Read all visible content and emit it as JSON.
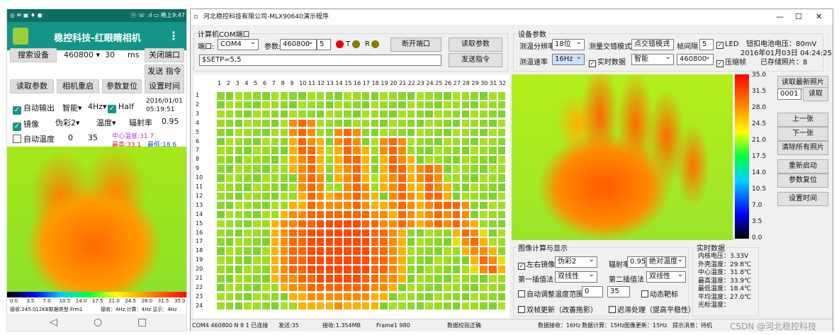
{
  "phone": {
    "status_left": "◎ ✉ ▣ ♦ ●",
    "status_right": "ⓝ ☏ .ıl ▭ 晚上9:47",
    "app_title": "稳控科技-红眼睛相机",
    "menu_icon": "⋮",
    "search_button": "搜索设备",
    "baud": "460800",
    "ms_value": "30",
    "ms_label": "ms",
    "close_port": "关闭端口",
    "send_cmd": "发送 指令",
    "read_params": "读取参数",
    "restart": "相机重启",
    "reset_params": "参数复位",
    "set_time": "设置时间",
    "auto_output": "自动输出",
    "mode": "智能",
    "freq": "4Hz",
    "half": "Half",
    "date": "2016/01/01",
    "time": "05:19:51",
    "mirror": "镜像",
    "palette": "伪彩2",
    "temp_label": "温度",
    "emis_label": "辐射率",
    "emis_value": "0.95",
    "auto_temp": "自动温度",
    "tmin": "0",
    "tmax": "35",
    "center_temp": "中心温度:31.7",
    "max_temp": "最高:33.1",
    "min_temp": "最低:18.6",
    "scale": [
      "0.0",
      "3.5",
      "7.0",
      "10.5",
      "14.0",
      "17.5",
      "21.0",
      "24.5",
      "28.0",
      "31.5",
      "35.0"
    ],
    "footer_left": "接收:245.012KB数据类型:Frm1",
    "footer_right": "接收：4Hz 计算：4Hz 显示：4Hz",
    "nav_back": "◁",
    "nav_home": "○",
    "nav_recent": "□"
  },
  "win": {
    "title": "河北稳控科技有限公司-MLX90640演示程序",
    "min": "—",
    "max": "☐",
    "close": "✕",
    "com_group": "计算机COM端口",
    "port_label": "端口:",
    "port_value": "COM4",
    "param_label": "参数:",
    "param_value": "460800",
    "param_num": "5",
    "t_label": "T",
    "r_label": "R",
    "disconnect": "断开端口",
    "read_params": "读取参数",
    "cmd_value": "$SETP=5,5",
    "send_cmd": "发送指令",
    "dev_group": "设备参数",
    "res_label": "测温分辨率",
    "res_value": "18位",
    "interleave_label": "测量交错模式",
    "interleave_value": "点交错模式",
    "interval_label": "帧间隔",
    "interval_value": "5",
    "led_label": "LED",
    "rate_label": "测温速率",
    "rate_value": "16Hz",
    "realtime_label": "实时数据",
    "mode_value": "智能",
    "baud_value": "460800",
    "compress_label": "压缩帧",
    "battery": "钮扣电池电压：80mV",
    "datetime": "2016年01月03日 04:24:25",
    "photos": "已存储照片：8",
    "cols": [
      "1",
      "2",
      "3",
      "4",
      "5",
      "6",
      "7",
      "8",
      "9",
      "10",
      "11",
      "12",
      "13",
      "14",
      "15",
      "16",
      "17",
      "18",
      "19",
      "20",
      "21",
      "22",
      "23",
      "24",
      "25",
      "26",
      "27",
      "28",
      "29",
      "30",
      "31",
      "32"
    ],
    "rows": [
      "1",
      "2",
      "3",
      "4",
      "5",
      "6",
      "7",
      "8",
      "9",
      "10",
      "11",
      "12",
      "13",
      "14",
      "15",
      "16",
      "17",
      "18",
      "19",
      "20",
      "21",
      "22",
      "23",
      "24"
    ],
    "scale": [
      "35.0",
      "31.5",
      "28.0",
      "24.5",
      "21.0",
      "17.5",
      "14.0",
      "10.5",
      "7.0",
      "3.5",
      "0.0"
    ],
    "read_latest": "读取最新照片",
    "photo_num": "0001",
    "read": "读取",
    "prev": "上一张",
    "next": "下一张",
    "clear_all": "清除所有照片",
    "restart": "重新启动",
    "reset": "参数复位",
    "set_time": "设置时间",
    "img_group": "图像计算与显示",
    "mirror_label": "左右镜像",
    "palette_value": "伪彩2",
    "emis_label": "辐射率",
    "emis_value": "0.95",
    "abs_temp": "绝对温度",
    "interp1_label": "第一插值法",
    "interp1_value": "双线性",
    "interp2_label": "第二插值法",
    "interp2_value": "双线性",
    "auto_range": "自动调整温度范围",
    "range_min": "0",
    "range_max": "35",
    "dyn_target": "动态靶标",
    "dbl_buffer": "双帧更新（改善拖影）",
    "delay_proc": "迟滞处理（提高平稳性）",
    "rt_group": "实时数据",
    "rt_lines": [
      "内核电压：3.33V",
      "外壳温度：29.8℃",
      "中心温度：31.8℃",
      "最高温度：33.9℃",
      "最低温度：18.4℃",
      "平均温度：27.0℃",
      "光标温度："
    ],
    "status_items": [
      "COM4 460800 N 8 1 已连接",
      "发送:35",
      "接收:1.354MB",
      "Frame1 980",
      "数据校验正确",
      "数据接收：16Hz",
      "数据计算：15Hz",
      "图像更新：15Hz",
      "提示消息：待机"
    ]
  },
  "watermark": "CSDN @河北稳控科技"
}
